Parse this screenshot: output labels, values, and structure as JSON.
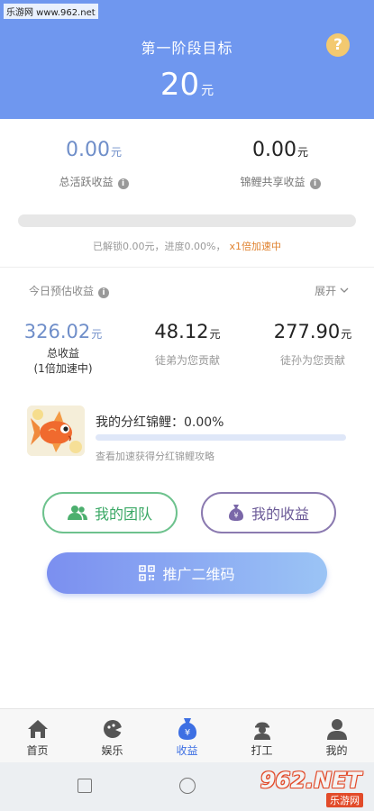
{
  "watermark_top": "乐游网 www.962.net",
  "header": {
    "title": "第一阶段目标",
    "goal_value": "20",
    "goal_unit": "元",
    "help": "?"
  },
  "summary": {
    "active_income": {
      "value": "0.00",
      "unit": "元",
      "label": "总活跃收益"
    },
    "carp_shared_income": {
      "value": "0.00",
      "unit": "元",
      "label": "锦鲤共享收益"
    }
  },
  "progress": {
    "percent": 0.0,
    "text": "已解锁0.00元，进度0.00%，",
    "accel": "x1倍加速中"
  },
  "forecast": {
    "title": "今日预估收益",
    "expand": "展开",
    "total": {
      "value": "326.02",
      "unit": "元",
      "label": "总收益",
      "note": "(1倍加速中)"
    },
    "apprentice": {
      "value": "48.12",
      "unit": "元",
      "label": "徒弟为您贡献"
    },
    "grand_apprentice": {
      "value": "277.90",
      "unit": "元",
      "label": "徒孙为您贡献"
    }
  },
  "carp": {
    "label": "我的分红锦鲤：0.00%",
    "percent": 0.0,
    "hint": "查看加速获得分红锦鲤攻略"
  },
  "buttons": {
    "team": "我的团队",
    "earnings": "我的收益",
    "promote": "推广二维码"
  },
  "tabs": [
    {
      "label": "首页",
      "icon": "home-icon"
    },
    {
      "label": "娱乐",
      "icon": "game-icon"
    },
    {
      "label": "收益",
      "icon": "money-bag-icon",
      "active": true
    },
    {
      "label": "打工",
      "icon": "worker-icon"
    },
    {
      "label": "我的",
      "icon": "user-icon"
    }
  ],
  "watermark_logo": {
    "big": "962.NET",
    "small": "乐游网"
  },
  "colors": {
    "accent": "#6f97ef",
    "active_tab": "#3d6fe3",
    "team_green": "#3aa865",
    "earn_purple": "#6b5a97",
    "accel_orange": "#e0822f"
  }
}
